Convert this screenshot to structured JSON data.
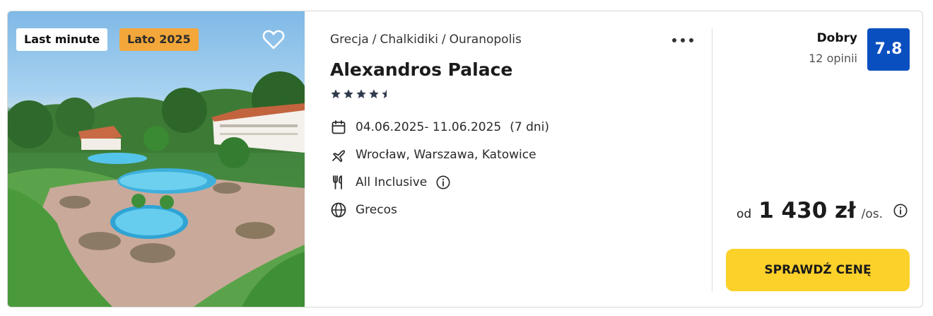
{
  "card": {
    "badges": [
      "Last minute",
      "Lato 2025"
    ],
    "breadcrumb": [
      "Grecja",
      "Chalkidiki",
      "Ouranopolis"
    ],
    "breadcrumb_separator": "/",
    "hotel_name": "Alexandros Palace",
    "stars": 4.5,
    "dates": "04.06.2025- 11.06.2025",
    "duration": "(7 dni)",
    "departures": "Wrocław, Warszawa, Katowice",
    "board": "All Inclusive",
    "operator": "Grecos",
    "rating_label": "Dobry",
    "rating_count": "12 opinii",
    "rating_score": "7.8",
    "price_prefix": "od",
    "price": "1 430 zł",
    "price_suffix": "/os.",
    "cta_label": "SPRAWDŹ CENĘ"
  },
  "icons": {
    "favorite": "heart-icon",
    "more": "more-dots-icon",
    "dates": "calendar-icon",
    "departures": "plane-icon",
    "board": "cutlery-icon",
    "board_info": "info-icon",
    "operator": "globe-icon",
    "price_info": "info-icon"
  },
  "colors": {
    "badge_season": "#f3a73a",
    "score_bg": "#0a4fc0",
    "cta_bg": "#fcd12a",
    "stars": "#2f3a4d"
  }
}
